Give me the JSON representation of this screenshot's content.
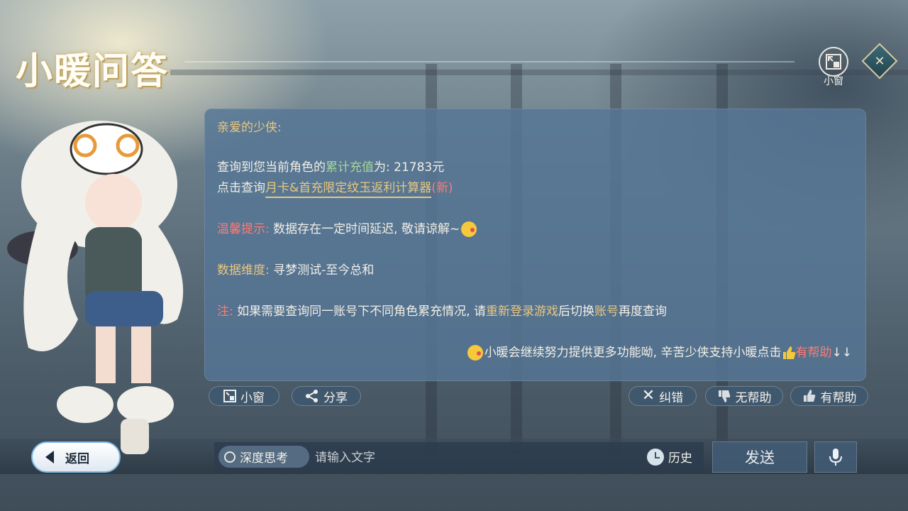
{
  "header": {
    "title": "小暖问答",
    "small_window_label": "小窗"
  },
  "message": {
    "greeting": "亲爱的少侠:",
    "query_prefix": "查询到您当前角色的",
    "query_key": "累计充值",
    "query_suffix": "为: 21783元",
    "click_prefix": "点击查询",
    "calculator_link": "月卡&首充限定纹玉返利计算器",
    "new_tag": "(新)",
    "tip_label": "温馨提示:",
    "tip_text": "数据存在一定时间延迟, 敬请谅解~",
    "dimension_label": "数据维度:",
    "dimension_value": "寻梦测试-至今总和",
    "note_label": "注:",
    "note_prefix": "如果需要查询同一账号下不同角色累充情况, 请",
    "note_relogin": "重新登录游戏",
    "note_middle": "后切换",
    "note_account": "账号",
    "note_suffix": "再度查询",
    "closing_text": "小暖会继续努力提供更多功能呦, 辛苦少侠支持小暖点击",
    "closing_helpful": "有帮助",
    "closing_arrows": "↓↓"
  },
  "actions": {
    "small_window": "小窗",
    "share": "分享",
    "correct": "纠错",
    "not_helpful": "无帮助",
    "helpful": "有帮助"
  },
  "footer": {
    "back": "返回",
    "deep_think": "深度思考",
    "input_placeholder": "请输入文字",
    "history": "历史",
    "send": "发送"
  },
  "icons": {
    "small_window": "small-window-icon",
    "menu": "diamond-menu-icon",
    "share": "share-icon",
    "correct": "cross-icon",
    "not_helpful": "thumbs-down-icon",
    "helpful": "thumbs-up-icon",
    "history": "clock-icon",
    "mic": "microphone-icon",
    "back": "back-arrow-icon"
  },
  "colors": {
    "gold": "#e9c77f",
    "green": "#a6d79a",
    "red": "#ff7a72"
  }
}
